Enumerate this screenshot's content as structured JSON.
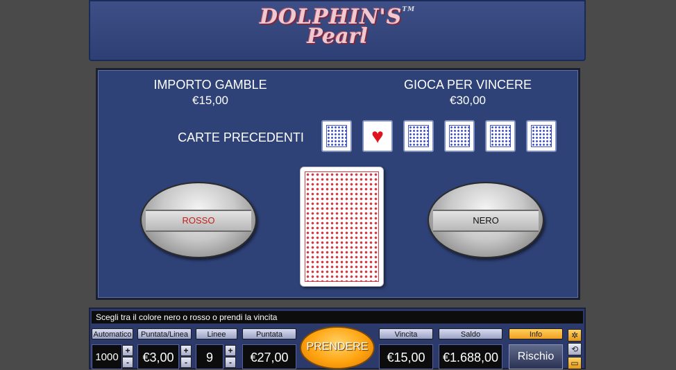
{
  "game": {
    "title_line1": "DOLPHIN'S",
    "title_line2": "Pearl",
    "trademark": "TM"
  },
  "gamble": {
    "importo_label": "IMPORTO GAMBLE",
    "importo_value": "€15,00",
    "gioca_label": "GIOCA PER VINCERE",
    "gioca_value": "€30,00",
    "previous_label": "CARTE PRECEDENTI",
    "previous_cards": [
      "back",
      "hearts",
      "back",
      "back",
      "back",
      "back"
    ],
    "red_button": "ROSSO",
    "black_button": "NERO",
    "red_color": "#c0201c",
    "black_color": "#111111"
  },
  "console": {
    "message": "Scegli tra il colore nero o rosso o prendi la vincita",
    "auto_label": "Automatico",
    "auto_value": "1000",
    "bet_line_label": "Puntata/Linea",
    "bet_line_value": "€3,00",
    "lines_label": "Linee",
    "lines_value": "9",
    "bet_label": "Puntata",
    "bet_value": "€27,00",
    "take_label": "PRENDERE",
    "win_label": "Vincita",
    "win_value": "€15,00",
    "balance_label": "Saldo",
    "balance_value": "€1.688,00",
    "info_label": "Info",
    "risk_label": "Rischio",
    "plus": "+",
    "minus": "-",
    "side_icons": [
      "settings-icon",
      "history-icon",
      "chat-icon"
    ]
  }
}
